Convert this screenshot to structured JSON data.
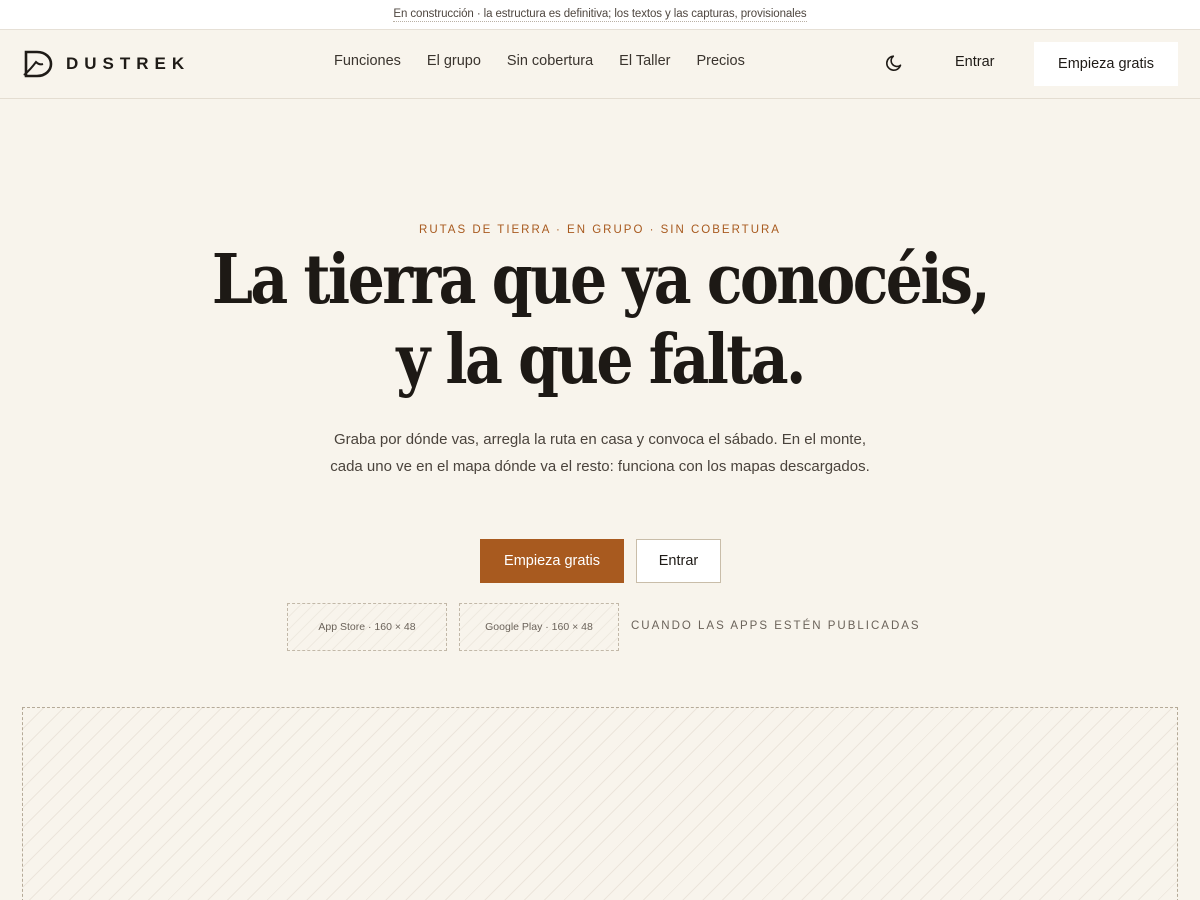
{
  "banner": {
    "text": "En construcción · la estructura es definitiva; los textos y las capturas, provisionales"
  },
  "brand": {
    "name": "DUSTREK",
    "accent": "#a85a1f",
    "background": "#f8f4ec"
  },
  "nav": {
    "items": [
      {
        "label": "Funciones"
      },
      {
        "label": "El grupo"
      },
      {
        "label": "Sin cobertura"
      },
      {
        "label": "El Taller"
      },
      {
        "label": "Precios"
      }
    ],
    "theme_icon": "moon-icon",
    "login_label": "Entrar",
    "cta_label": "Empieza gratis"
  },
  "hero": {
    "eyebrow": "RUTAS DE TIERRA · EN GRUPO · SIN COBERTURA",
    "title_line1": "La tierra que ya conocéis,",
    "title_line2": "y la que falta.",
    "subtitle": "Graba por dónde vas, arregla la ruta en casa y convoca el sábado. En el monte, cada uno ve en el mapa dónde va el resto: funciona con los mapas descargados.",
    "primary_cta": "Empieza gratis",
    "secondary_cta": "Entrar",
    "stores": {
      "ios": "App Store · 160 × 48",
      "android": "Google Play · 160 × 48",
      "note": "CUANDO LAS APPS ESTÉN PUBLICADAS"
    }
  }
}
